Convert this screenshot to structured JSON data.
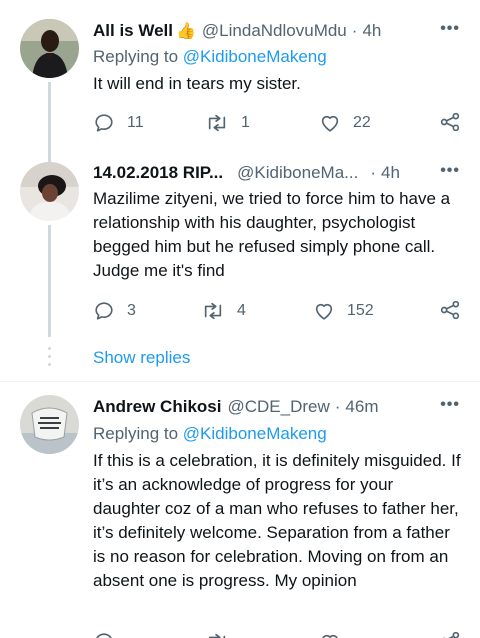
{
  "tweets": [
    {
      "name": "All is Well",
      "emoji": "👍",
      "handle": "@LindaNdlovuMdu",
      "dot": "·",
      "time": "4h",
      "replying_prefix": "Replying to ",
      "replying_to": "@KidiboneMakeng",
      "text": "It will end in tears my sister.",
      "replies": "11",
      "retweets": "1",
      "likes": "22"
    },
    {
      "name": "14.02.2018 RIP...",
      "handle": "@KidiboneMa...",
      "dot": "·",
      "time": "4h",
      "text": "Mazilime zityeni, we tried to force him to have a relationship with his daughter, psychologist begged him but he refused simply phone call. Judge me it's find",
      "replies": "3",
      "retweets": "4",
      "likes": "152"
    },
    {
      "name": "Andrew Chikosi",
      "handle": "@CDE_Drew",
      "dot": "·",
      "time": "46m",
      "replying_prefix": "Replying to ",
      "replying_to": "@KidiboneMakeng",
      "text": "If this is a celebration, it is definitely misguided. If it’s an acknowledge of progress for your daughter coz of a man who refuses to father her, it’s definitely welcome. Separation from a father is no reason for celebration. Moving on from an absent one is progress. My opinion"
    }
  ],
  "show_replies": "Show replies",
  "more_glyph": "•••",
  "colors": {
    "accent": "#1d9bf0",
    "muted": "#536471",
    "text": "#0f1419",
    "thread": "#cfd9de"
  },
  "icons": [
    "reply-icon",
    "retweet-icon",
    "like-icon",
    "share-icon",
    "more-icon"
  ]
}
